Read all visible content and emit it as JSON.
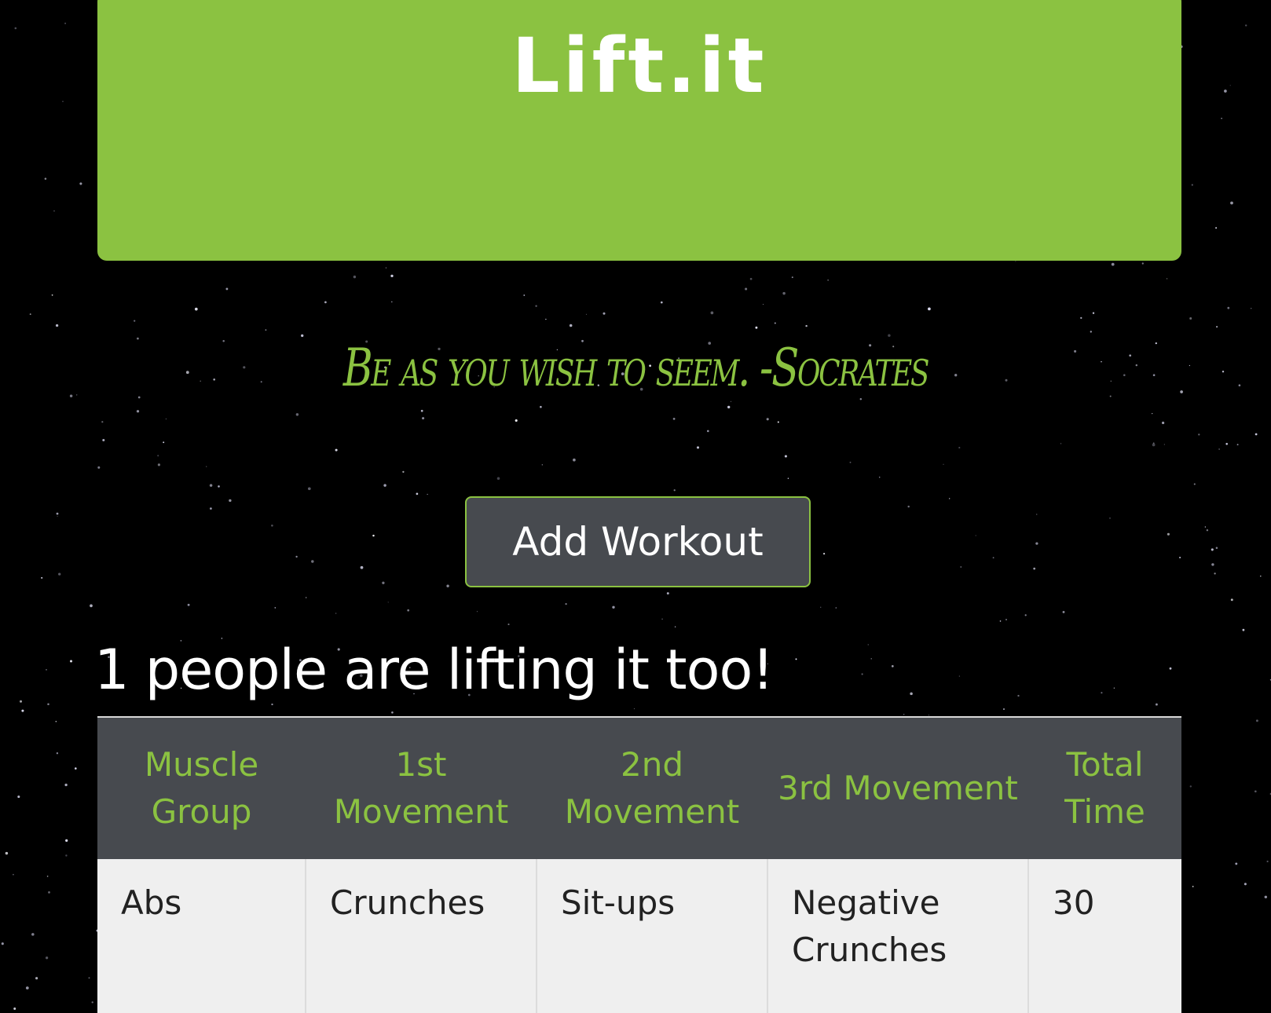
{
  "header": {
    "brand": "Lift.it"
  },
  "quote": {
    "text": "Be as you wish to seem. -Socrates"
  },
  "actions": {
    "add_workout_label": "Add Workout"
  },
  "community": {
    "heading": "1 people are lifting it too!"
  },
  "workouts_table": {
    "columns": [
      "Muscle Group",
      "1st Movement",
      "2nd Movement",
      "3rd Movement",
      "Total Time"
    ],
    "rows": [
      [
        "Abs",
        "Crunches",
        "Sit-ups",
        "Negative Crunches",
        "30"
      ]
    ]
  },
  "colors": {
    "accent": "#8bc241",
    "button_bg": "#474a4f",
    "table_header_bg": "#474a4f",
    "table_row_bg": "#efefef",
    "page_bg": "#000000"
  }
}
